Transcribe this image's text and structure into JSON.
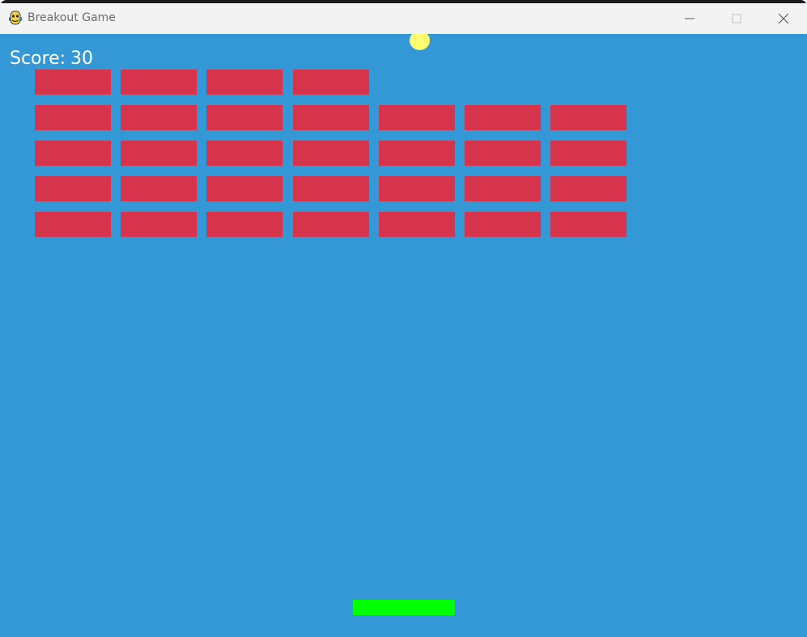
{
  "window": {
    "title": "Breakout Game",
    "icon": "python-icon",
    "controls": [
      "minimize-icon",
      "maximize-icon",
      "close-icon"
    ]
  },
  "game": {
    "score_label": "Score:",
    "score_value": "30",
    "colors": {
      "background": "#3598d6",
      "brick": "#d6334d",
      "ball": "#fdfc70",
      "paddle": "#00ff00",
      "score_text": "#ffffff"
    },
    "brick_rows": [
      [
        true,
        true,
        true,
        true,
        false,
        false,
        false
      ],
      [
        true,
        true,
        true,
        true,
        true,
        true,
        true
      ],
      [
        true,
        true,
        true,
        true,
        true,
        true,
        true
      ],
      [
        true,
        true,
        true,
        true,
        true,
        true,
        true
      ],
      [
        true,
        true,
        true,
        true,
        true,
        true,
        true
      ]
    ]
  }
}
